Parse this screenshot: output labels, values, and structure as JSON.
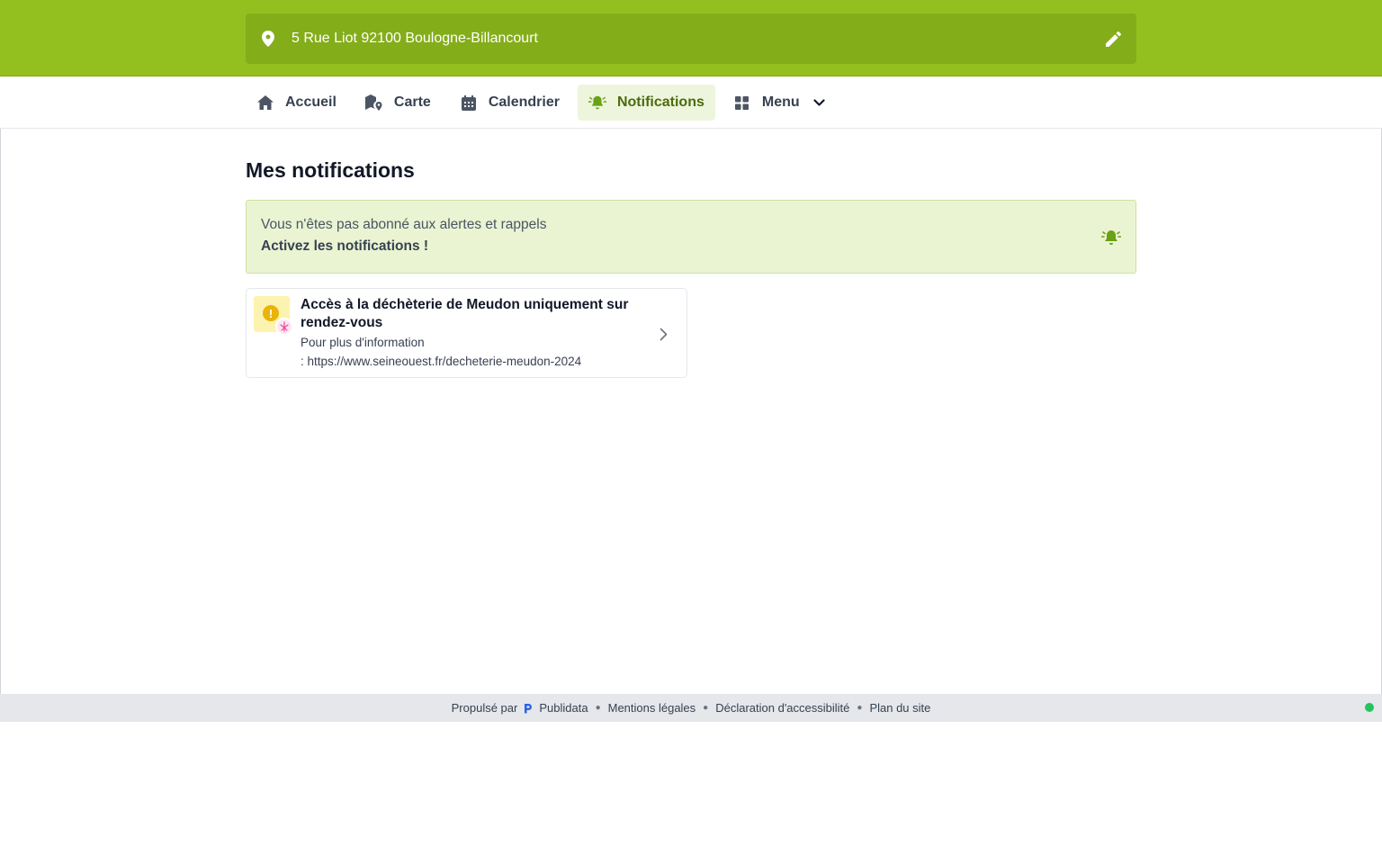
{
  "header": {
    "address": "5 Rue Liot 92100 Boulogne-Billancourt",
    "pin_icon": "map-pin-icon",
    "edit_icon": "pencil-icon"
  },
  "nav": {
    "items": [
      {
        "label": "Accueil",
        "icon": "home-icon"
      },
      {
        "label": "Carte",
        "icon": "map-icon"
      },
      {
        "label": "Calendrier",
        "icon": "calendar-icon"
      },
      {
        "label": "Notifications",
        "icon": "bell-icon",
        "active": true
      },
      {
        "label": "Menu",
        "icon": "grid-icon"
      }
    ]
  },
  "main": {
    "title": "Mes notifications",
    "alert": {
      "line1": "Vous n'êtes pas abonné aux alertes et rappels",
      "line2": "Activez les notifications !"
    },
    "notification": {
      "title": "Accès à la déchèterie de Meudon uniquement sur rendez-vous",
      "body_line1": "Pour plus d'information",
      "body_line2": ": https://www.seineouest.fr/decheterie-meudon-2024"
    }
  },
  "footer": {
    "powered_by": "Propulsé par",
    "brand": "Publidata",
    "links": [
      "Mentions légales",
      "Déclaration d'accessibilité",
      "Plan du site"
    ]
  },
  "colors": {
    "brand_green": "#93c01f",
    "address_bar": "#84ad1a",
    "active_tab_bg": "#eef5dd",
    "alert_bg": "#eaf4d3",
    "warning_yellow": "#eab308",
    "status_green": "#22c55e"
  }
}
